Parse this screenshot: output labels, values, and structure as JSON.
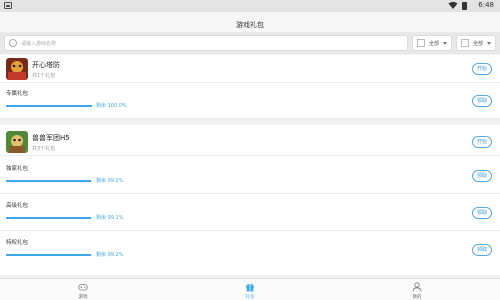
{
  "status_bar": {
    "time": "6:48"
  },
  "header": {
    "title": "游戏礼包"
  },
  "search": {
    "placeholder": "请输入游戏名称"
  },
  "filters": [
    {
      "label": "全部"
    },
    {
      "label": "全部"
    }
  ],
  "games": [
    {
      "name": "开心塔防",
      "gift_count": "共1个礼包",
      "action_label": "开始",
      "gifts": [
        {
          "name": "专属礼包",
          "remaining": "剩余 100.0%",
          "fraction": 1.0,
          "action_label": "领取"
        }
      ]
    },
    {
      "name": "兽兽军团H5",
      "gift_count": "共3个礼包",
      "action_label": "开始",
      "gifts": [
        {
          "name": "独家礼包",
          "remaining": "剩余 99.2%",
          "fraction": 0.992,
          "action_label": "领取"
        },
        {
          "name": "高级礼包",
          "remaining": "剩余 99.1%",
          "fraction": 0.991,
          "action_label": "领取"
        },
        {
          "name": "特权礼包",
          "remaining": "剩余 99.2%",
          "fraction": 0.992,
          "action_label": "领取"
        }
      ]
    }
  ],
  "tabs": [
    {
      "label": "游戏",
      "icon": "gamepad-icon",
      "active": false
    },
    {
      "label": "礼包",
      "icon": "gift-icon",
      "active": true
    },
    {
      "label": "我的",
      "icon": "user-icon",
      "active": false
    }
  ],
  "colors": {
    "accent": "#39a8e8",
    "bar_track": "#dfeef9",
    "page_bg": "#f1f1f1"
  }
}
